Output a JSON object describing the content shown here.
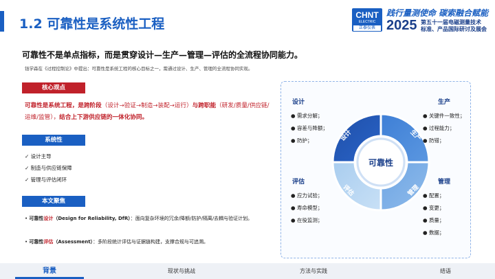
{
  "header": {
    "title": "1.2  可靠性是系统性工程",
    "logo_text": "CHNT",
    "logo_sub": "ELECTRIC",
    "logo_brand": "正泰仪表",
    "slogan": "践行量测使命  碳索融合赋能",
    "year": "2025",
    "conference_line1": "第五十一届电磁测量技术",
    "conference_line2": "标准、产品国际研讨及展会"
  },
  "lead": "可靠性不是单点指标，而是贯穿设计—生产—管理—评估的全流程协同能力。",
  "quote": "钱学森在《过程控制论》中提出：可靠性是系统工程的核心目标之一，需通过设计、生产、管理的全流程协同实现。",
  "core": {
    "tag": "核心观点",
    "part1": "可靠性是系统工程，是跨阶段",
    "part2": "（设计→验证→制造→装配→运行）",
    "part3": "与跨职能",
    "part4": "（研发/质量/供应链/运维/监管），",
    "part5": "结合上下游供应链的一体化协同。"
  },
  "systemic": {
    "tag": "系统性",
    "items": [
      "✓ 设计主导",
      "✓ 制造与供应链保障",
      "✓ 管理与评估闭环"
    ]
  },
  "focus": {
    "tag": "本文聚焦",
    "line1_prefix": "可靠性",
    "line1_hl": "设计",
    "line1_en": "（Design for Reliability, DfR）",
    "line1_rest": "：面向复杂环境的冗余/降额/防护/隔离/去耦与验证计划。",
    "line2_prefix": "可靠性",
    "line2_hl": "评估",
    "line2_en": "（Assessment）",
    "line2_rest": "：多阶段统计评估与证据链构建，支撑合规与可追溯。"
  },
  "diagram": {
    "center": "可靠性",
    "segments": [
      "设计",
      "生产",
      "管理",
      "评估"
    ],
    "design": {
      "title": "设计",
      "items": [
        "需求分解；",
        "容差与降额；",
        "防护；"
      ]
    },
    "production": {
      "title": "生产",
      "items": [
        "关键件一致性；",
        "过程能力；",
        "防错；"
      ]
    },
    "evaluation": {
      "title": "评估",
      "items": [
        "应力试验；",
        "寿命模型；",
        "在役监测；"
      ]
    },
    "management": {
      "title": "管理",
      "items": [
        "配置；",
        "变更；",
        "质量；",
        "数据；"
      ]
    }
  },
  "tabs": [
    "背景",
    "现状与挑战",
    "方法与实践",
    "结语"
  ],
  "colors": {
    "primary": "#1a5fc2",
    "accent": "#c0212a"
  }
}
